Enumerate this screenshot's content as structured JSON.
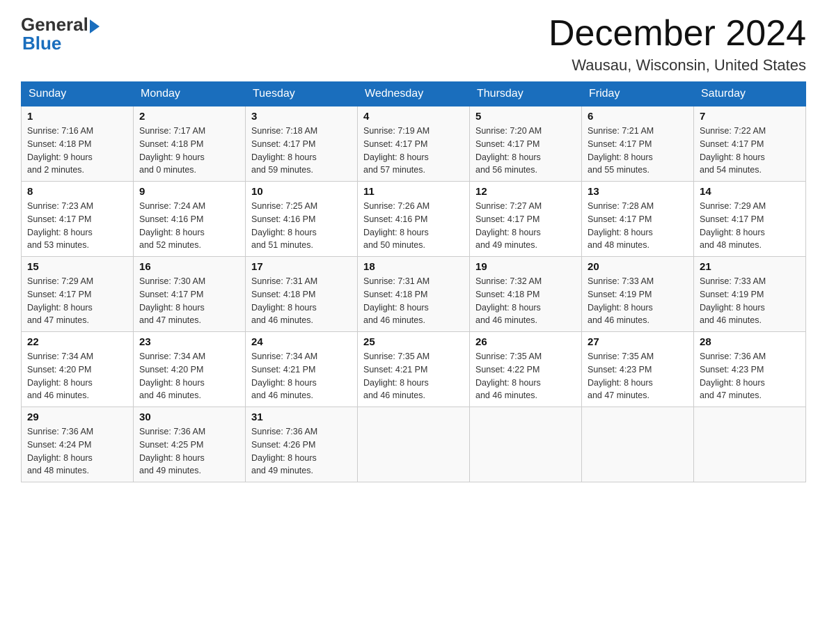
{
  "logo": {
    "general": "General",
    "blue": "Blue"
  },
  "title": "December 2024",
  "location": "Wausau, Wisconsin, United States",
  "days_of_week": [
    "Sunday",
    "Monday",
    "Tuesday",
    "Wednesday",
    "Thursday",
    "Friday",
    "Saturday"
  ],
  "weeks": [
    [
      {
        "day": "1",
        "sunrise": "7:16 AM",
        "sunset": "4:18 PM",
        "daylight": "9 hours and 2 minutes."
      },
      {
        "day": "2",
        "sunrise": "7:17 AM",
        "sunset": "4:18 PM",
        "daylight": "9 hours and 0 minutes."
      },
      {
        "day": "3",
        "sunrise": "7:18 AM",
        "sunset": "4:17 PM",
        "daylight": "8 hours and 59 minutes."
      },
      {
        "day": "4",
        "sunrise": "7:19 AM",
        "sunset": "4:17 PM",
        "daylight": "8 hours and 57 minutes."
      },
      {
        "day": "5",
        "sunrise": "7:20 AM",
        "sunset": "4:17 PM",
        "daylight": "8 hours and 56 minutes."
      },
      {
        "day": "6",
        "sunrise": "7:21 AM",
        "sunset": "4:17 PM",
        "daylight": "8 hours and 55 minutes."
      },
      {
        "day": "7",
        "sunrise": "7:22 AM",
        "sunset": "4:17 PM",
        "daylight": "8 hours and 54 minutes."
      }
    ],
    [
      {
        "day": "8",
        "sunrise": "7:23 AM",
        "sunset": "4:17 PM",
        "daylight": "8 hours and 53 minutes."
      },
      {
        "day": "9",
        "sunrise": "7:24 AM",
        "sunset": "4:16 PM",
        "daylight": "8 hours and 52 minutes."
      },
      {
        "day": "10",
        "sunrise": "7:25 AM",
        "sunset": "4:16 PM",
        "daylight": "8 hours and 51 minutes."
      },
      {
        "day": "11",
        "sunrise": "7:26 AM",
        "sunset": "4:16 PM",
        "daylight": "8 hours and 50 minutes."
      },
      {
        "day": "12",
        "sunrise": "7:27 AM",
        "sunset": "4:17 PM",
        "daylight": "8 hours and 49 minutes."
      },
      {
        "day": "13",
        "sunrise": "7:28 AM",
        "sunset": "4:17 PM",
        "daylight": "8 hours and 48 minutes."
      },
      {
        "day": "14",
        "sunrise": "7:29 AM",
        "sunset": "4:17 PM",
        "daylight": "8 hours and 48 minutes."
      }
    ],
    [
      {
        "day": "15",
        "sunrise": "7:29 AM",
        "sunset": "4:17 PM",
        "daylight": "8 hours and 47 minutes."
      },
      {
        "day": "16",
        "sunrise": "7:30 AM",
        "sunset": "4:17 PM",
        "daylight": "8 hours and 47 minutes."
      },
      {
        "day": "17",
        "sunrise": "7:31 AM",
        "sunset": "4:18 PM",
        "daylight": "8 hours and 46 minutes."
      },
      {
        "day": "18",
        "sunrise": "7:31 AM",
        "sunset": "4:18 PM",
        "daylight": "8 hours and 46 minutes."
      },
      {
        "day": "19",
        "sunrise": "7:32 AM",
        "sunset": "4:18 PM",
        "daylight": "8 hours and 46 minutes."
      },
      {
        "day": "20",
        "sunrise": "7:33 AM",
        "sunset": "4:19 PM",
        "daylight": "8 hours and 46 minutes."
      },
      {
        "day": "21",
        "sunrise": "7:33 AM",
        "sunset": "4:19 PM",
        "daylight": "8 hours and 46 minutes."
      }
    ],
    [
      {
        "day": "22",
        "sunrise": "7:34 AM",
        "sunset": "4:20 PM",
        "daylight": "8 hours and 46 minutes."
      },
      {
        "day": "23",
        "sunrise": "7:34 AM",
        "sunset": "4:20 PM",
        "daylight": "8 hours and 46 minutes."
      },
      {
        "day": "24",
        "sunrise": "7:34 AM",
        "sunset": "4:21 PM",
        "daylight": "8 hours and 46 minutes."
      },
      {
        "day": "25",
        "sunrise": "7:35 AM",
        "sunset": "4:21 PM",
        "daylight": "8 hours and 46 minutes."
      },
      {
        "day": "26",
        "sunrise": "7:35 AM",
        "sunset": "4:22 PM",
        "daylight": "8 hours and 46 minutes."
      },
      {
        "day": "27",
        "sunrise": "7:35 AM",
        "sunset": "4:23 PM",
        "daylight": "8 hours and 47 minutes."
      },
      {
        "day": "28",
        "sunrise": "7:36 AM",
        "sunset": "4:23 PM",
        "daylight": "8 hours and 47 minutes."
      }
    ],
    [
      {
        "day": "29",
        "sunrise": "7:36 AM",
        "sunset": "4:24 PM",
        "daylight": "8 hours and 48 minutes."
      },
      {
        "day": "30",
        "sunrise": "7:36 AM",
        "sunset": "4:25 PM",
        "daylight": "8 hours and 49 minutes."
      },
      {
        "day": "31",
        "sunrise": "7:36 AM",
        "sunset": "4:26 PM",
        "daylight": "8 hours and 49 minutes."
      },
      null,
      null,
      null,
      null
    ]
  ]
}
